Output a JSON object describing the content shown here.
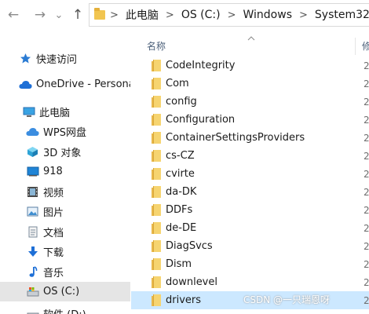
{
  "address": {
    "crumbs": [
      "此电脑",
      "OS (C:)",
      "Windows",
      "System32"
    ],
    "separator": ">"
  },
  "nav": {
    "back": "←",
    "forward": "→",
    "history": "⌄",
    "up": "↑"
  },
  "sidebar": {
    "items": [
      {
        "label": "快速访问",
        "icon": "star-icon"
      },
      {
        "label": "OneDrive - Persona",
        "icon": "cloud-icon"
      },
      {
        "label": "此电脑",
        "icon": "computer-icon"
      },
      {
        "label": "WPS网盘",
        "icon": "cloud-icon"
      },
      {
        "label": "3D 对象",
        "icon": "cube-icon"
      },
      {
        "label": "918",
        "icon": "monitor-icon"
      },
      {
        "label": "视频",
        "icon": "film-icon"
      },
      {
        "label": "图片",
        "icon": "picture-icon"
      },
      {
        "label": "文档",
        "icon": "document-icon"
      },
      {
        "label": "下载",
        "icon": "download-icon"
      },
      {
        "label": "音乐",
        "icon": "music-icon"
      },
      {
        "label": "OS (C:)",
        "icon": "drive-icon"
      },
      {
        "label": "软件 (D:)",
        "icon": "drive-icon"
      }
    ],
    "selected_index": 11
  },
  "columns": {
    "name": "名称",
    "date": "修"
  },
  "files": [
    {
      "name": "CodeIntegrity",
      "date": "2"
    },
    {
      "name": "Com",
      "date": "2"
    },
    {
      "name": "config",
      "date": "2"
    },
    {
      "name": "Configuration",
      "date": "2"
    },
    {
      "name": "ContainerSettingsProviders",
      "date": "2"
    },
    {
      "name": "cs-CZ",
      "date": "2"
    },
    {
      "name": "cvirte",
      "date": "2"
    },
    {
      "name": "da-DK",
      "date": "2"
    },
    {
      "name": "DDFs",
      "date": "2"
    },
    {
      "name": "de-DE",
      "date": "2"
    },
    {
      "name": "DiagSvcs",
      "date": "2"
    },
    {
      "name": "Dism",
      "date": "2"
    },
    {
      "name": "downlevel",
      "date": "2"
    },
    {
      "name": "drivers",
      "date": "2"
    }
  ],
  "selected_file_index": 13,
  "watermark": "CSDN @一只瑞恩呀",
  "colors": {
    "selected_row": "#cce8ff",
    "selected_nav": "#e5e5e5",
    "folder": "#f6d470",
    "header_text": "#4c607a"
  }
}
